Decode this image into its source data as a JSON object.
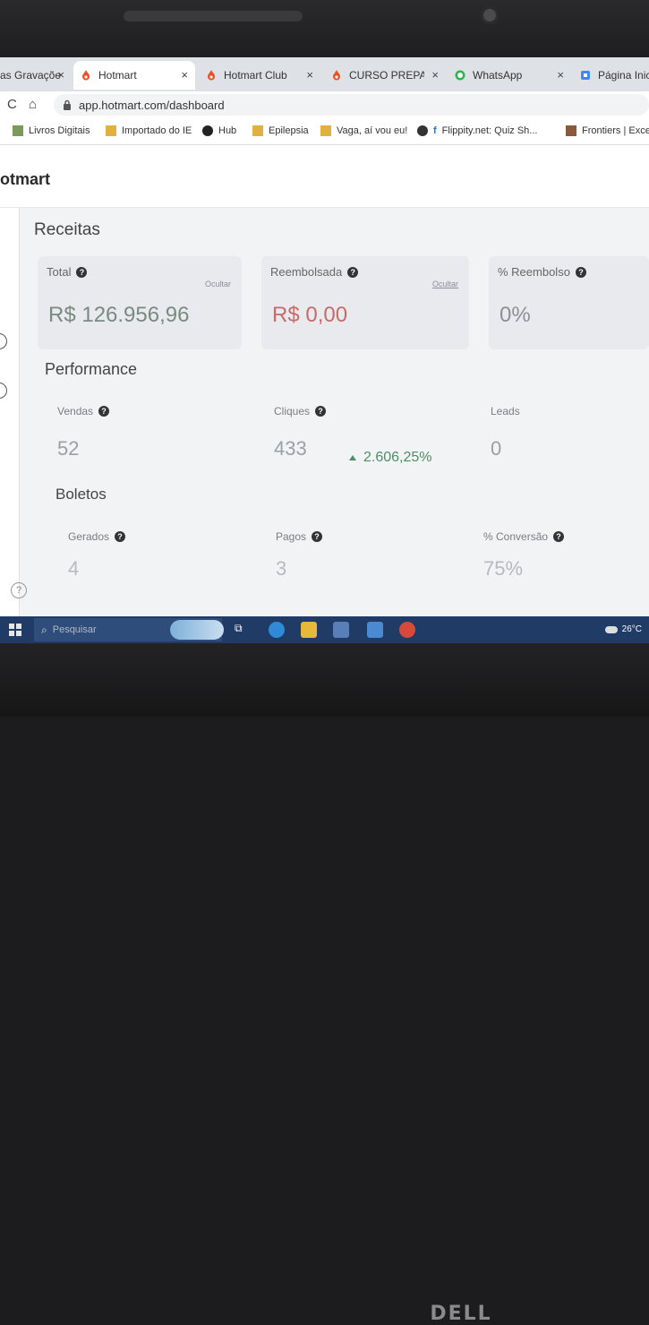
{
  "browser": {
    "tabs": [
      {
        "title": "as Gravaçõe",
        "active": false
      },
      {
        "title": "Hotmart",
        "active": true
      },
      {
        "title": "Hotmart Club",
        "active": false
      },
      {
        "title": "CURSO PREPARA",
        "active": false
      },
      {
        "title": "WhatsApp",
        "active": false
      },
      {
        "title": "Página Inicia",
        "active": false
      }
    ],
    "close_glyph": "×",
    "url": "app.hotmart.com/dashboard",
    "bookmarks": [
      "Livros Digitais",
      "Importado do IE",
      "Hub",
      "Epilepsia",
      "Vaga, aí vou eu!",
      "Flippity.net: Quiz Sh...",
      "Frontiers | Exce"
    ]
  },
  "app": {
    "brand": "otmart"
  },
  "receitas": {
    "title": "Receitas",
    "total": {
      "label": "Total",
      "hide": "Ocultar",
      "value": "R$ 126.956,96"
    },
    "reembolsada": {
      "label": "Reembolsada",
      "hide": "Ocultar",
      "value": "R$ 0,00"
    },
    "reembolso": {
      "label": "% Reembolso",
      "value": "0%"
    }
  },
  "performance": {
    "title": "Performance",
    "vendas": {
      "label": "Vendas",
      "value": "52"
    },
    "cliques": {
      "label": "Cliques",
      "value": "433",
      "trend": "2.606,25%"
    },
    "leads": {
      "label": "Leads",
      "value": "0"
    }
  },
  "boletos": {
    "title": "Boletos",
    "gerados": {
      "label": "Gerados",
      "value": "4"
    },
    "pagos": {
      "label": "Pagos",
      "value": "3"
    },
    "conversao": {
      "label": "% Conversão",
      "value": "75%"
    }
  },
  "taskbar": {
    "search_placeholder": "Pesquisar",
    "temperature": "26°C"
  },
  "device": {
    "logo": "DELL"
  },
  "colors": {
    "hotmart_orange": "#f04e23",
    "positive_green": "#4d8f66",
    "refund_red": "#c96a6a",
    "taskbar_blue": "#1f3b66"
  }
}
